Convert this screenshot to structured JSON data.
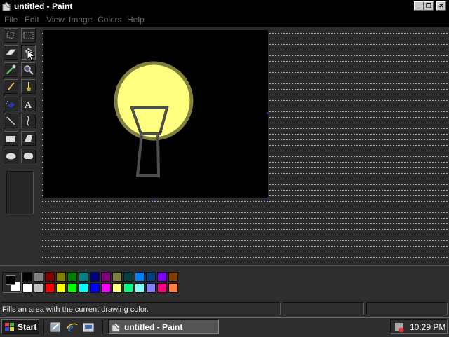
{
  "window": {
    "title": "untitled - Paint"
  },
  "title_buttons": [
    {
      "name": "minimize-button",
      "glyph": "_"
    },
    {
      "name": "maximize-button",
      "glyph": "❐"
    },
    {
      "name": "close-button",
      "glyph": "✕"
    }
  ],
  "menu": [
    "File",
    "Edit",
    "View",
    "Image",
    "Colors",
    "Help"
  ],
  "tools": [
    {
      "name": "free-form-select-tool",
      "icon": "free-select-icon"
    },
    {
      "name": "select-tool",
      "icon": "rect-select-icon"
    },
    {
      "name": "eraser-tool",
      "icon": "eraser-icon"
    },
    {
      "name": "fill-with-color-tool",
      "icon": "paint-bucket-icon",
      "selected": true
    },
    {
      "name": "pick-color-tool",
      "icon": "eyedropper-icon"
    },
    {
      "name": "magnifier-tool",
      "icon": "magnifier-icon"
    },
    {
      "name": "pencil-tool",
      "icon": "pencil-icon"
    },
    {
      "name": "brush-tool",
      "icon": "brush-icon"
    },
    {
      "name": "airbrush-tool",
      "icon": "airbrush-icon"
    },
    {
      "name": "text-tool",
      "icon": "text-icon"
    },
    {
      "name": "line-tool",
      "icon": "line-icon"
    },
    {
      "name": "curve-tool",
      "icon": "curve-icon"
    },
    {
      "name": "rectangle-tool",
      "icon": "rectangle-icon"
    },
    {
      "name": "polygon-tool",
      "icon": "polygon-icon"
    },
    {
      "name": "ellipse-tool",
      "icon": "ellipse-icon"
    },
    {
      "name": "rounded-rectangle-tool",
      "icon": "rounded-rectangle-icon"
    }
  ],
  "palette": {
    "top": [
      "#000000",
      "#808080",
      "#800000",
      "#808000",
      "#008000",
      "#008080",
      "#000080",
      "#800080",
      "#808040",
      "#004040",
      "#0080ff",
      "#004080",
      "#8000ff",
      "#804000"
    ],
    "bottom": [
      "#ffffff",
      "#c0c0c0",
      "#ff0000",
      "#ffff00",
      "#00ff00",
      "#00ffff",
      "#0000ff",
      "#ff00ff",
      "#ffff80",
      "#00ff80",
      "#80ffff",
      "#8080ff",
      "#ff0080",
      "#ff8040"
    ],
    "foreground": "#000000",
    "background": "#ffffff"
  },
  "drawing": {
    "canvas_color": "#000000",
    "bulb_fill": "#ffff80",
    "bulb_outline": "#808040",
    "base_outline": "#4d4d4d"
  },
  "status": {
    "text": "Fills an area with the current drawing color."
  },
  "taskbar": {
    "start_label": "Start",
    "quick_launch": [
      "desktop-icon",
      "internet-explorer-icon",
      "channels-icon"
    ],
    "task_label": "untitled - Paint",
    "clock": "10:29 PM"
  }
}
